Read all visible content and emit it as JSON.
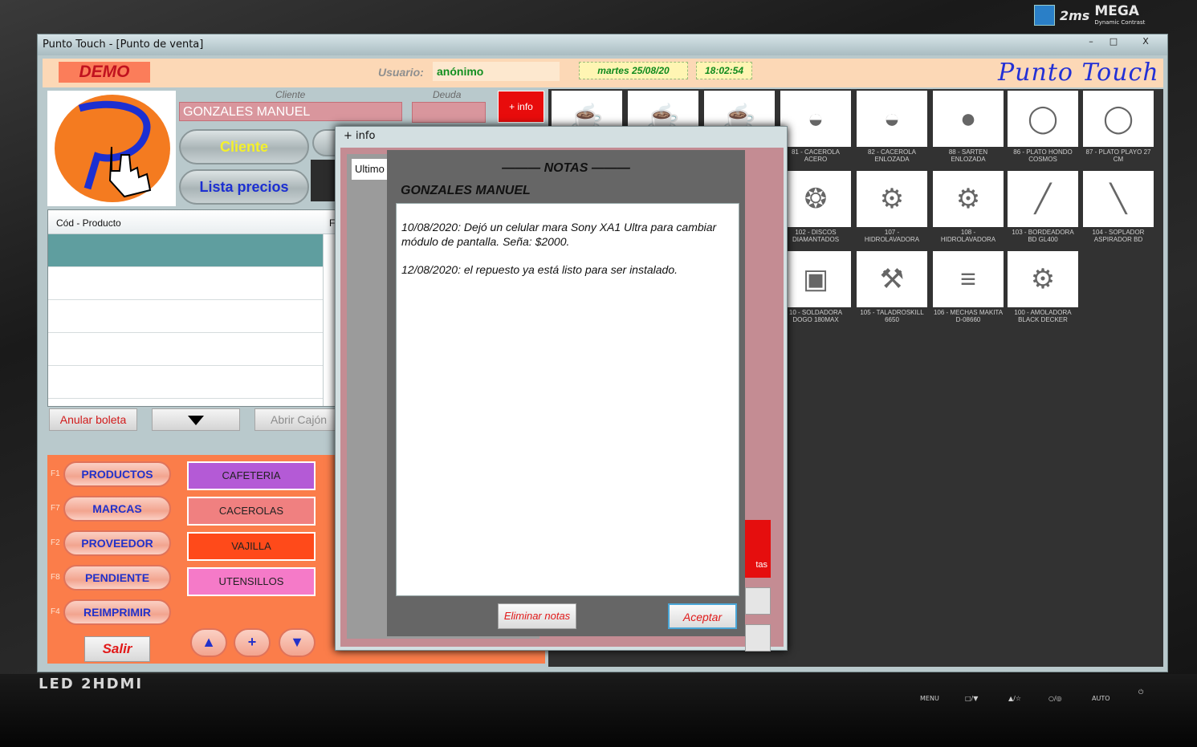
{
  "window": {
    "title": "Punto Touch - [Punto de venta]",
    "buttons": [
      "–",
      "□",
      "X"
    ]
  },
  "header": {
    "demo": "DEMO",
    "usuario_label": "Usuario:",
    "usuario": "anónimo",
    "date": "martes 25/08/20",
    "time": "18:02:54",
    "brand": "Punto Touch"
  },
  "client": {
    "caption": "Cliente",
    "name": "GONZALES MANUEL",
    "debt_caption": "Deuda",
    "info_button": "+ info",
    "cliente_button": "Cliente",
    "lista_button": "Lista precios"
  },
  "grid": {
    "col1": "Cód - Producto",
    "col2": "F"
  },
  "actions": {
    "anular": "Anular boleta",
    "abrir_cajon": "Abrir Cajón"
  },
  "menu": [
    {
      "key": "F1",
      "label": "PRODUCTOS"
    },
    {
      "key": "F7",
      "label": "MARCAS"
    },
    {
      "key": "F2",
      "label": "PROVEEDOR"
    },
    {
      "key": "F8",
      "label": "PENDIENTE"
    },
    {
      "key": "F4",
      "label": "REIMPRIMIR"
    }
  ],
  "categories": [
    {
      "label": "CAFETERIA",
      "color": "#b45ad6"
    },
    {
      "label": "CACEROLAS",
      "color": "#f08080"
    },
    {
      "label": "VAJILLA",
      "color": "#ff4a1a"
    },
    {
      "label": "UTENSILLOS",
      "color": "#f57ac8"
    }
  ],
  "salir": "Salir",
  "nav": {
    "up": "▲",
    "plus": "+",
    "down": "▼"
  },
  "products": [
    {
      "caption": "",
      "icon": "kettle-icon"
    },
    {
      "caption": "",
      "icon": "kettle-icon"
    },
    {
      "caption": "",
      "icon": "kettle-icon"
    },
    {
      "caption": "81 - CACEROLA ACERO",
      "icon": "pot-icon"
    },
    {
      "caption": "82 - CACEROLA ENLOZADA",
      "icon": "pot-icon"
    },
    {
      "caption": "88 - SARTEN ENLOZADA",
      "icon": "pan-icon"
    },
    {
      "caption": "86 - PLATO HONDO COSMOS",
      "icon": "plate-icon"
    },
    {
      "caption": "87 - PLATO PLAYO 27 CM",
      "icon": "plate-icon"
    },
    {
      "caption": "102 - DISCOS DIAMANTADOS",
      "icon": "disc-icon"
    },
    {
      "caption": "107 - HIDROLAVADORA",
      "icon": "washer-icon"
    },
    {
      "caption": "108 - HIDROLAVADORA",
      "icon": "washer-icon"
    },
    {
      "caption": "103 - BORDEADORA BD GL400",
      "icon": "trimmer-icon"
    },
    {
      "caption": "104 - SOPLADOR ASPIRADOR BD",
      "icon": "blower-icon"
    },
    {
      "caption": "10 - SOLDADORA DOGO 180MAX",
      "icon": "welder-icon"
    },
    {
      "caption": "105 - TALADROSKILL 6650",
      "icon": "drill-icon"
    },
    {
      "caption": "106 - MECHAS MAKITA D-08660",
      "icon": "bits-icon"
    },
    {
      "caption": "100 - AMOLADORA BLACK DECKER",
      "icon": "grinder-icon"
    }
  ],
  "info_dialog": {
    "title": "+ info",
    "ultimo": "Ultimo",
    "notas_label": "tas"
  },
  "notas": {
    "title": "——— NOTAS ———",
    "client": "GONZALES MANUEL",
    "note1": "10/08/2020: Dejó un celular mara Sony XA1 Ultra para cambiar módulo de pantalla. Seña: $2000.",
    "note2": "12/08/2020: el repuesto ya está listo para ser instalado.",
    "eliminar": "Eliminar notas",
    "aceptar": "Aceptar"
  },
  "monitor": {
    "led": "LED 2HDMI",
    "ms": "2ms",
    "mega": "MEGA",
    "mega_sub": "Dynamic Contrast",
    "buttons": [
      "MENU",
      "□/▼",
      "▲/☆",
      "○/◎",
      "AUTO",
      "⏻"
    ]
  }
}
